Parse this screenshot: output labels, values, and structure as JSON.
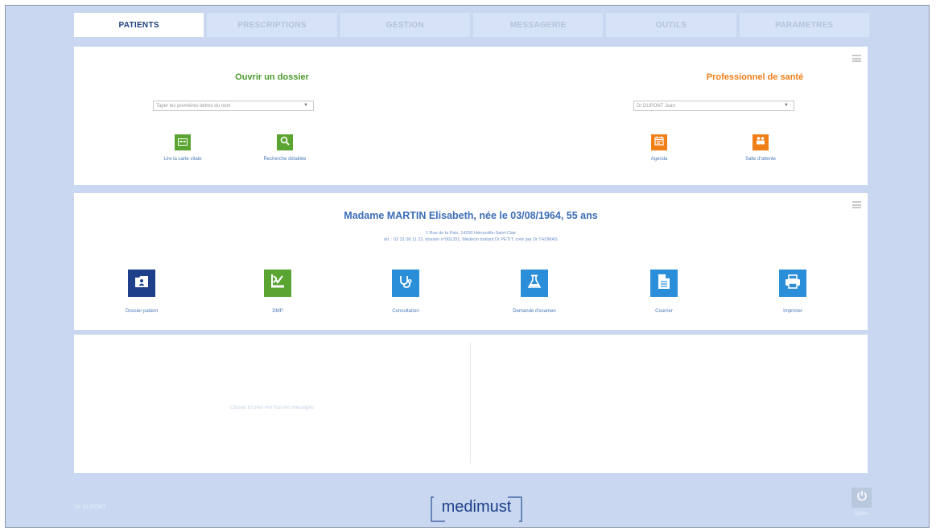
{
  "tabs": [
    {
      "label": "PATIENTS"
    },
    {
      "label": "PRESCRIPTIONS"
    },
    {
      "label": "GESTION"
    },
    {
      "label": "MESSAGERIE"
    },
    {
      "label": "OUTILS"
    },
    {
      "label": "PARAMETRES"
    }
  ],
  "open_file": {
    "title": "Ouvrir un dossier",
    "search_placeholder": "Taper les premières lettres du nom",
    "actions": [
      {
        "label": "Lire la carte vitale",
        "icon": "vitale-card-icon"
      },
      {
        "label": "Recherche détaillée",
        "icon": "search-icon"
      }
    ]
  },
  "professional": {
    "title": "Professionnel de santé",
    "selected": "Dr DUPONT Jean",
    "actions": [
      {
        "label": "Agenda",
        "icon": "calendar-icon"
      },
      {
        "label": "Salle d'attente",
        "icon": "waiting-room-icon"
      }
    ]
  },
  "patient": {
    "title": "Madame MARTIN Elisabeth, née le 03/08/1964, 55 ans",
    "address": "1 Rue de la Paix, 14200 Hérouville-Saint-Clair",
    "details": "tél. : 02 31 08 11 22, dossier n°001331, Médecin traitant Dr PETIT, créé par Dr THOMAS",
    "actions": [
      {
        "label": "Dossier patient",
        "icon": "patient-file-icon",
        "color": "#1e3f8a"
      },
      {
        "label": "DMP",
        "icon": "dmp-icon",
        "color": "#5aa532"
      },
      {
        "label": "Consultation",
        "icon": "stethoscope-icon",
        "color": "#2a8fd8"
      },
      {
        "label": "Demande d'examen",
        "icon": "flask-icon",
        "color": "#2a8fd8"
      },
      {
        "label": "Courrier",
        "icon": "document-icon",
        "color": "#2a8fd8"
      },
      {
        "label": "Imprimer",
        "icon": "printer-icon",
        "color": "#2a8fd8"
      }
    ]
  },
  "messages": {
    "hint": "Cliquez ici pour voir tous les messages"
  },
  "footer": {
    "user": "Dr DUPONT",
    "logo": "medimust",
    "quit_label": "Quitter"
  },
  "colors": {
    "background": "#c9d8f0",
    "green": "#5aa532",
    "orange": "#f07f17",
    "navy": "#1e3f8a",
    "blue": "#2a8fd8",
    "tab_active_text": "#1f3f7a"
  }
}
